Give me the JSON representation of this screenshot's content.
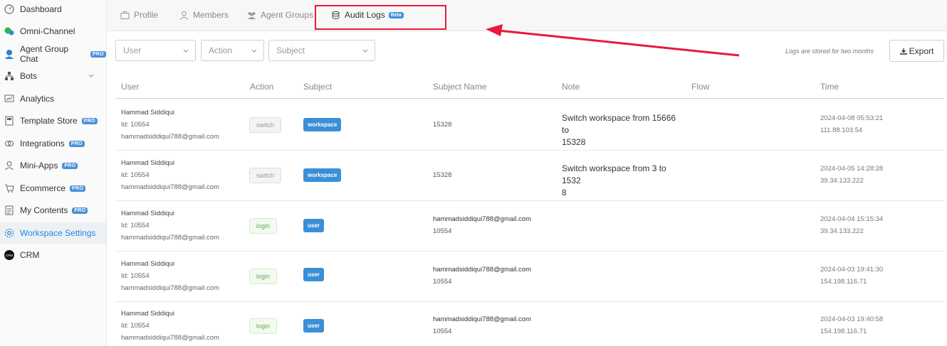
{
  "sidebar": {
    "items": [
      {
        "label": "Dashboard",
        "icon": "dashboard-icon",
        "pro": false
      },
      {
        "label": "Omni-Channel",
        "icon": "chat-bubbles-icon",
        "pro": false
      },
      {
        "label": "Agent Group Chat",
        "icon": "agent-icon",
        "pro": true
      },
      {
        "label": "Bots",
        "icon": "bots-icon",
        "pro": false,
        "expandable": true
      },
      {
        "label": "Analytics",
        "icon": "analytics-icon",
        "pro": false
      },
      {
        "label": "Template Store",
        "icon": "template-icon",
        "pro": true
      },
      {
        "label": "Integrations",
        "icon": "integrations-icon",
        "pro": true
      },
      {
        "label": "Mini-Apps",
        "icon": "user-icon",
        "pro": true
      },
      {
        "label": "Ecommerce",
        "icon": "cart-icon",
        "pro": true
      },
      {
        "label": "My Contents",
        "icon": "document-icon",
        "pro": true
      },
      {
        "label": "Workspace Settings",
        "icon": "gear-icon",
        "pro": false,
        "active": true
      },
      {
        "label": "CRM",
        "icon": "crm-icon",
        "pro": false
      }
    ],
    "pro_label": "PRO"
  },
  "tabs": [
    {
      "label": "Profile",
      "icon": "briefcase-icon"
    },
    {
      "label": "Members",
      "icon": "user-icon"
    },
    {
      "label": "Agent Groups",
      "icon": "users-icon"
    },
    {
      "label": "Audit Logs",
      "icon": "database-icon",
      "badge": "Beta",
      "active": true
    }
  ],
  "filters": {
    "user_placeholder": "User",
    "action_placeholder": "Action",
    "subject_placeholder": "Subject"
  },
  "logs_note": "Logs are stored for two months",
  "export_label": "Export",
  "table": {
    "columns": [
      "User",
      "Action",
      "Subject",
      "Subject Name",
      "Note",
      "Flow",
      "Time"
    ],
    "rows": [
      {
        "name": "Hammad Siddiqui",
        "id": "Id: 10554",
        "email": "hammadsiddiqui788@gmail.com",
        "action": "switch",
        "subject": "workspace",
        "subject_name_1": "15328",
        "subject_name_2": "",
        "note_1": "Switch workspace from 15666 to",
        "note_2": "15328",
        "time": "2024-04-08 05:53:21",
        "ip": "111.88.103.54"
      },
      {
        "name": "Hammad Siddiqui",
        "id": "Id: 10554",
        "email": "hammadsiddiqui788@gmail.com",
        "action": "switch",
        "subject": "workspace",
        "subject_name_1": "15328",
        "subject_name_2": "",
        "note_1": "Switch workspace from 3 to 1532",
        "note_2": "8",
        "time": "2024-04-05 14:28:28",
        "ip": "39.34.133.222"
      },
      {
        "name": "Hammad Siddiqui",
        "id": "Id: 10554",
        "email": "hammadsiddiqui788@gmail.com",
        "action": "login",
        "subject": "user",
        "subject_name_1": "hammadsiddiqui788@gmail.com",
        "subject_name_2": "10554",
        "note_1": "",
        "note_2": "",
        "time": "2024-04-04 15:15:34",
        "ip": "39.34.133.222"
      },
      {
        "name": "Hammad Siddiqui",
        "id": "Id: 10554",
        "email": "hammadsiddiqui788@gmail.com",
        "action": "login",
        "subject": "user",
        "subject_name_1": "hammadsiddiqui788@gmail.com",
        "subject_name_2": "10554",
        "note_1": "",
        "note_2": "",
        "time": "2024-04-03 19:41:30",
        "ip": "154.198.116.71"
      },
      {
        "name": "Hammad Siddiqui",
        "id": "Id: 10554",
        "email": "hammadsiddiqui788@gmail.com",
        "action": "login",
        "subject": "user",
        "subject_name_1": "hammadsiddiqui788@gmail.com",
        "subject_name_2": "10554",
        "note_1": "",
        "note_2": "",
        "time": "2024-04-03 19:40:58",
        "ip": "154.198.116.71"
      }
    ]
  },
  "colors": {
    "accent": "#1e88e5",
    "highlight": "#e8193e",
    "subject_badge": "#3a8fd6"
  }
}
